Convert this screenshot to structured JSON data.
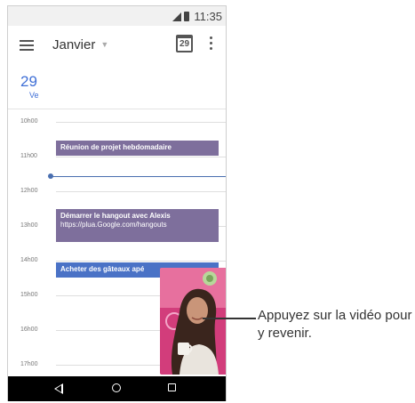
{
  "status_bar": {
    "time": "11:35",
    "icons": [
      "signal-icon",
      "battery-icon"
    ]
  },
  "app_bar": {
    "month": "Janvier",
    "today_icon_number": "29",
    "icons": [
      "menu-icon",
      "calendar-today-icon",
      "more-vert-icon"
    ]
  },
  "day_header": {
    "day_number": "29",
    "day_name": "Ve",
    "color": "#3f6fd6"
  },
  "timeline": {
    "hours": [
      "10h00",
      "11h00",
      "12h00",
      "13h00",
      "14h00",
      "15h00",
      "16h00",
      "17h00"
    ]
  },
  "events": [
    {
      "title": "Réunion de projet hebdomadaire",
      "color": "#7e6f9c"
    },
    {
      "title": "Démarrer le hangout avec Alexis",
      "link": "https://plua.Google.com/hangouts",
      "color": "#7e6f9c"
    },
    {
      "title": "Acheter des gâteaux apé",
      "color": "#4a72c6"
    }
  ],
  "picture_in_picture": {
    "description_icon": "video-pip-icon"
  },
  "nav_bar": {
    "icons": [
      "back-icon",
      "home-icon",
      "recents-icon"
    ]
  },
  "callout": {
    "text": "Appuyez sur la vidéo pour y revenir."
  }
}
